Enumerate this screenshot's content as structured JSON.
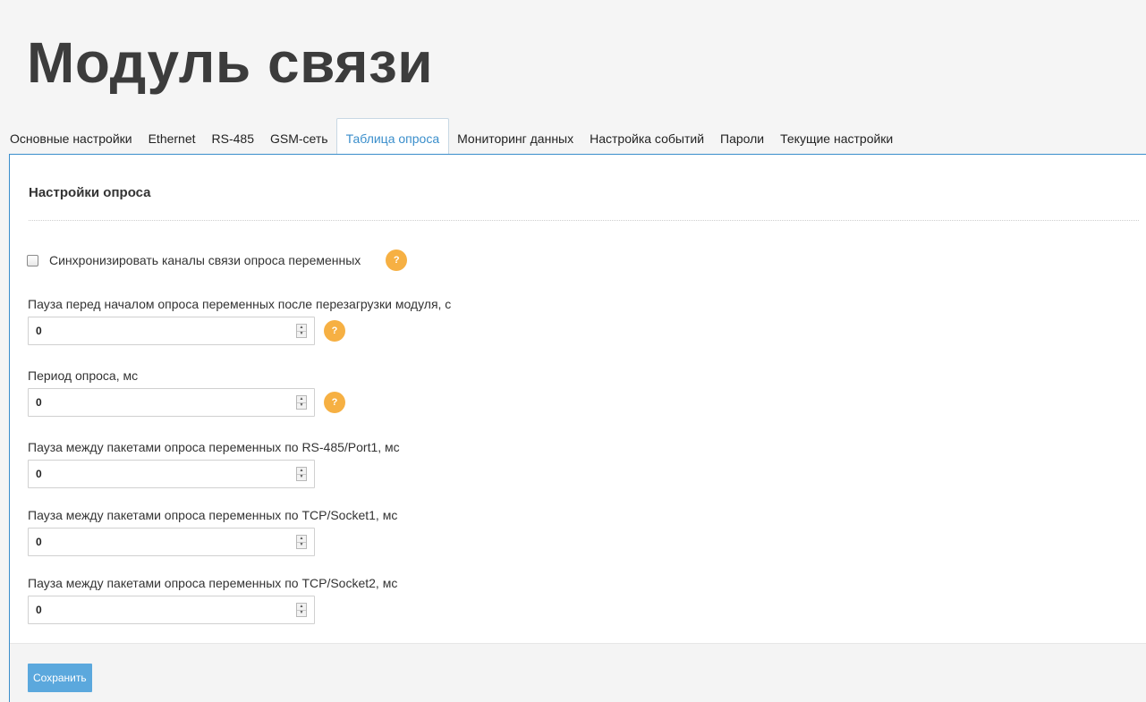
{
  "header": {
    "title": "Модуль связи"
  },
  "tabs": [
    {
      "label": "Основные настройки",
      "active": false
    },
    {
      "label": "Ethernet",
      "active": false
    },
    {
      "label": "RS-485",
      "active": false
    },
    {
      "label": "GSM-сеть",
      "active": false
    },
    {
      "label": "Таблица опроса",
      "active": true
    },
    {
      "label": "Мониторинг данных",
      "active": false
    },
    {
      "label": "Настройка событий",
      "active": false
    },
    {
      "label": "Пароли",
      "active": false
    },
    {
      "label": "Текущие настройки",
      "active": false
    }
  ],
  "panel": {
    "heading": "Настройки опроса",
    "sync": {
      "label": "Синхронизировать каналы связи опроса переменных",
      "checked": false,
      "help": "?"
    },
    "fields": [
      {
        "label": "Пауза перед началом опроса переменных после перезагрузки модуля, с",
        "value": "0",
        "help": "?"
      },
      {
        "label": "Период опроса, мс",
        "value": "0",
        "help": "?"
      },
      {
        "label": "Пауза между пакетами опроса переменных по RS-485/Port1, мс",
        "value": "0"
      },
      {
        "label": "Пауза между пакетами опроса переменных по TCP/Socket1, мс",
        "value": "0"
      },
      {
        "label": "Пауза между пакетами опроса переменных по TCP/Socket2, мс",
        "value": "0"
      }
    ]
  },
  "footer": {
    "save_label": "Сохранить"
  },
  "colors": {
    "accent": "#3a8ecb",
    "help_badge": "#f6b043",
    "save_button": "#5ba8dd"
  },
  "icons": {
    "help": "question-circle-icon",
    "spinner_up": "caret-up-icon",
    "spinner_down": "caret-down-icon"
  }
}
